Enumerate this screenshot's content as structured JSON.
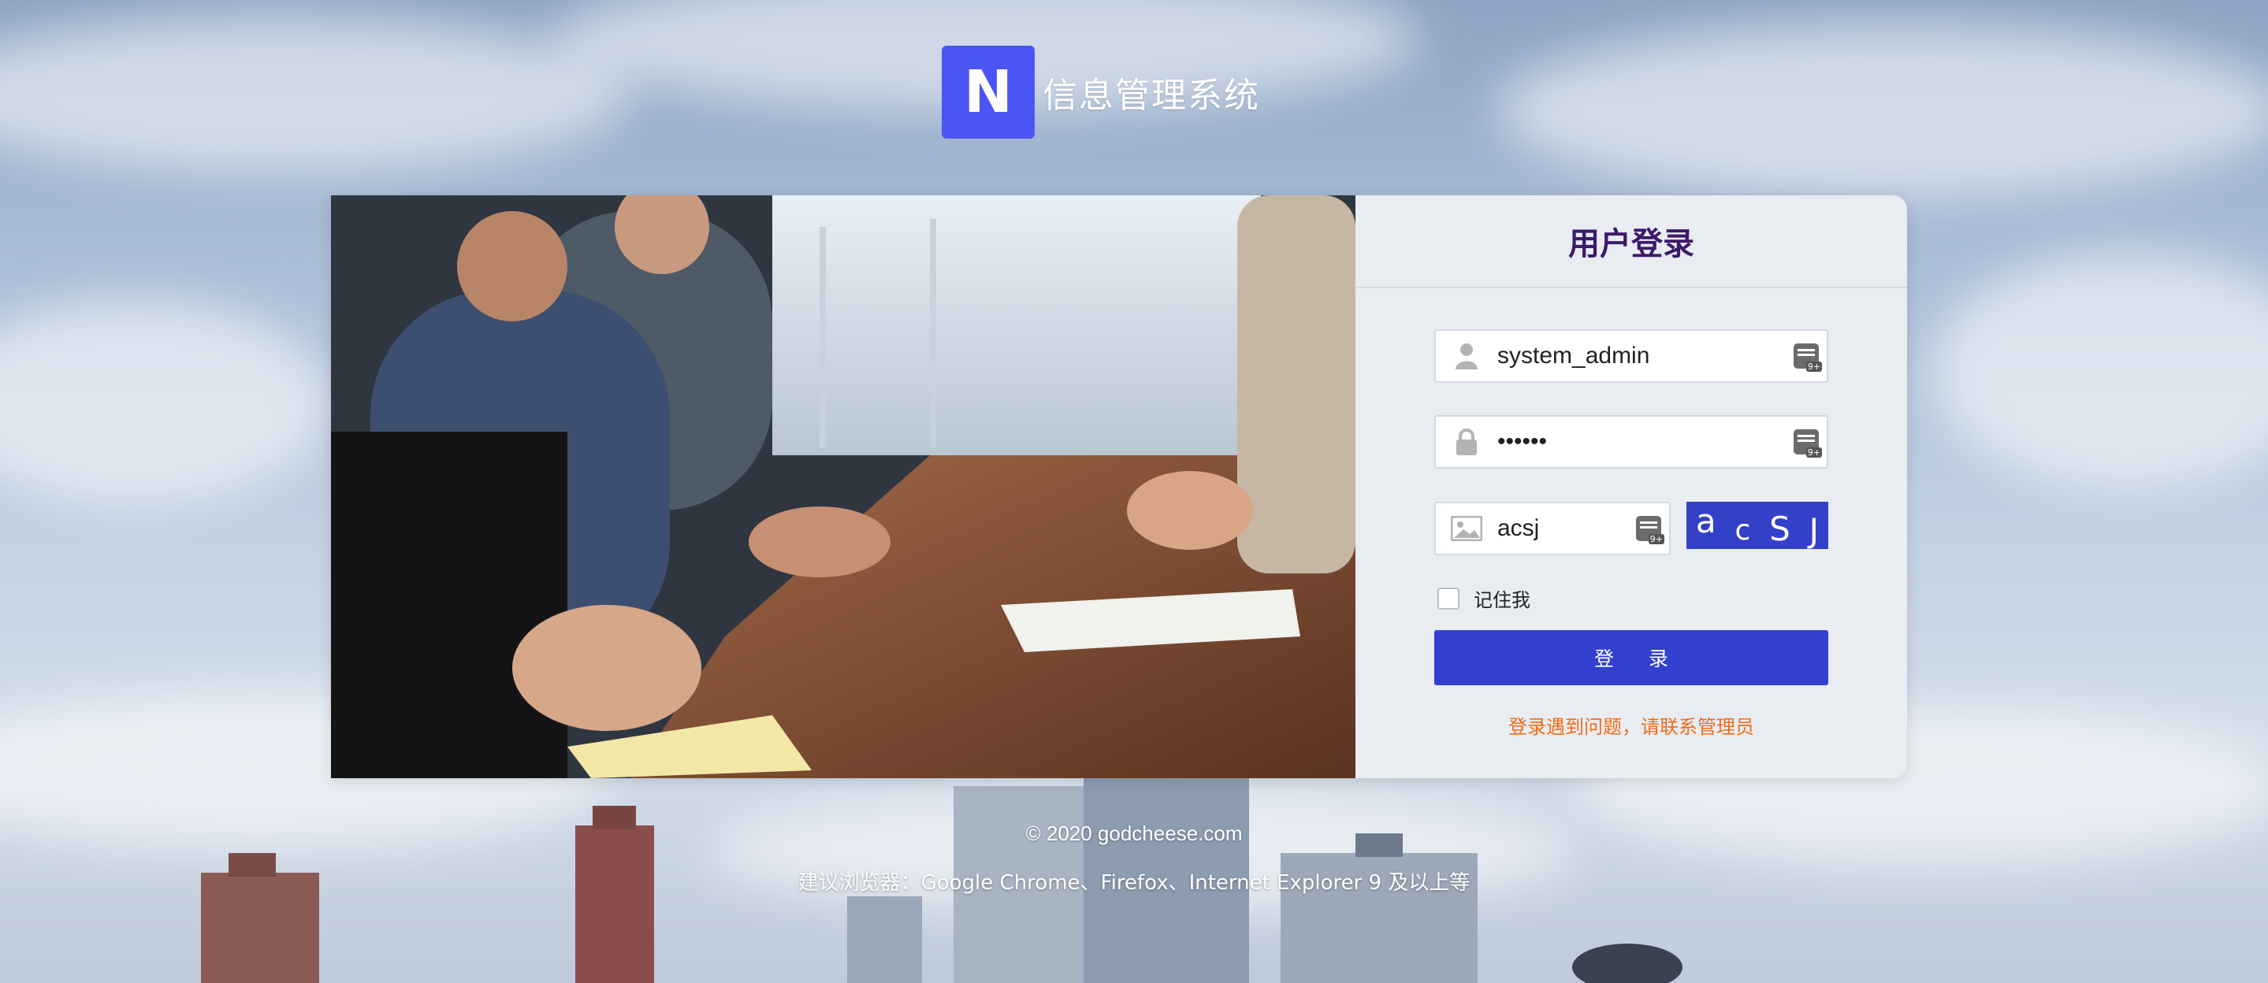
{
  "branding": {
    "logo_letter": "N",
    "title": "信息管理系统",
    "accent": "#4b55f4"
  },
  "login": {
    "title": "用户登录",
    "username_value": "system_admin",
    "password_value": "••••••",
    "captcha_value": "acsj",
    "captcha_image": [
      "a",
      "c",
      "S",
      "J"
    ],
    "remember_label": "记住我",
    "submit_label": "登 录",
    "help_link": "登录遇到问题，请联系管理员",
    "primary_color": "#3340cf",
    "help_color": "#f36a12"
  },
  "icons": {
    "username": "user-icon",
    "password": "lock-icon",
    "captcha": "image-icon",
    "keyboard": "keyboard-icon"
  },
  "footer": {
    "copyright": "© 2020 godcheese.com",
    "browsers": "建议浏览器：Google Chrome、Firefox、Internet Explorer 9 及以上等"
  }
}
